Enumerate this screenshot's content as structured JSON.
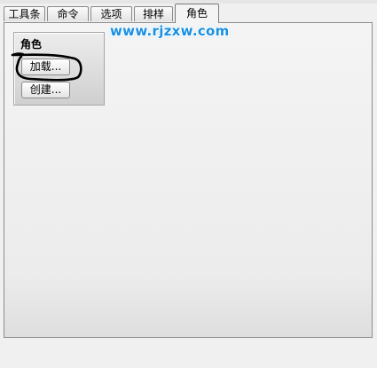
{
  "tabs": [
    {
      "label": "工具条",
      "active": false
    },
    {
      "label": "命令",
      "active": false
    },
    {
      "label": "选项",
      "active": false
    },
    {
      "label": "排样",
      "active": false
    },
    {
      "label": "角色",
      "active": true
    }
  ],
  "group": {
    "title": "角色",
    "buttons": {
      "load": "加载...",
      "create": "创建..."
    }
  },
  "watermark": "www.rjzxw.com",
  "colors": {
    "watermark": "#1a8fe0",
    "annotation": "#000000"
  }
}
